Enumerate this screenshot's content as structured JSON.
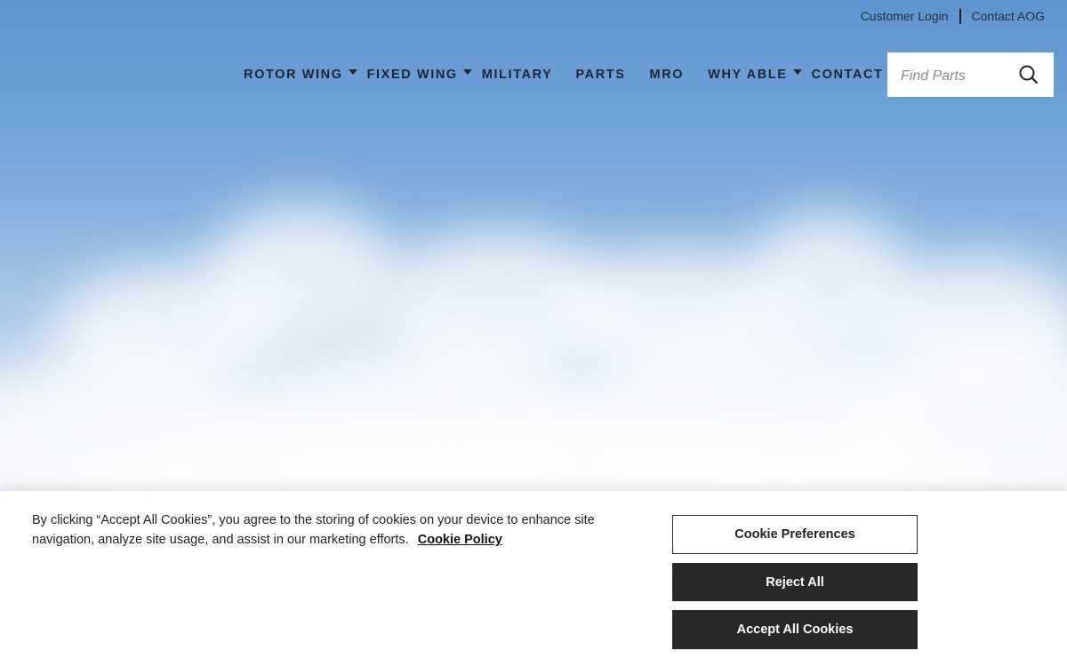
{
  "utility_bar": {
    "customer_login": "Customer Login",
    "separator": "|",
    "contact_aog": "Contact AOG"
  },
  "nav": {
    "items": [
      {
        "label": "ROTOR WING",
        "has_dropdown": true
      },
      {
        "label": "FIXED WING",
        "has_dropdown": true
      },
      {
        "label": "MILITARY",
        "has_dropdown": false
      },
      {
        "label": "PARTS",
        "has_dropdown": false
      },
      {
        "label": "MRO",
        "has_dropdown": false
      },
      {
        "label": "WHY ABLE",
        "has_dropdown": true
      },
      {
        "label": "CONTACT",
        "has_dropdown": false
      }
    ]
  },
  "search": {
    "placeholder": "Find Parts",
    "value": "",
    "icon": "search-icon"
  },
  "cookie_banner": {
    "message": "By clicking “Accept All Cookies”, you agree to the storing of cookies on your device to enhance site navigation, analyze site usage, and assist in our marketing efforts.",
    "policy_link": "Cookie Policy",
    "preferences_button": "Cookie Preferences",
    "reject_button": "Reject All",
    "accept_button": "Accept All Cookies"
  },
  "colors": {
    "sky_top": "#5f94cf",
    "cloud": "#ffffff",
    "nav_text": "#1d2630",
    "button_dark": "#282828"
  }
}
